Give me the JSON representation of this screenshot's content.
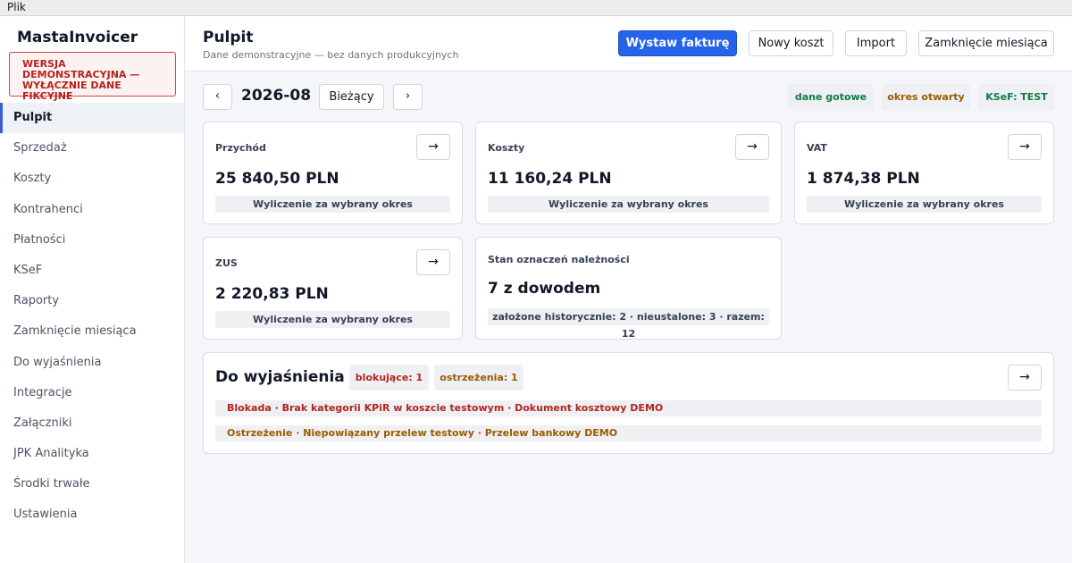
{
  "menubar": {
    "file": "Plik"
  },
  "sidebar": {
    "brand": "MastaInvoicer",
    "demo_banner": "WERSJA DEMONSTRACYJNA — WYŁĄCZNIE DANE FIKCYJNE",
    "items": [
      {
        "label": "Pulpit"
      },
      {
        "label": "Sprzedaż"
      },
      {
        "label": "Koszty"
      },
      {
        "label": "Kontrahenci"
      },
      {
        "label": "Płatności"
      },
      {
        "label": "KSeF"
      },
      {
        "label": "Raporty"
      },
      {
        "label": "Zamknięcie miesiąca"
      },
      {
        "label": "Do wyjaśnienia"
      },
      {
        "label": "Integracje"
      },
      {
        "label": "Załączniki"
      },
      {
        "label": "JPK Analityka"
      },
      {
        "label": "Środki trwałe"
      },
      {
        "label": "Ustawienia"
      }
    ]
  },
  "header": {
    "title": "Pulpit",
    "subtitle": "Dane demonstracyjne — bez danych produkcyjnych",
    "buttons": {
      "issue_invoice": "Wystaw fakturę",
      "new_cost": "Nowy koszt",
      "import": "Import",
      "month_close": "Zamknięcie miesiąca"
    }
  },
  "period": {
    "prev": "‹",
    "label": "2026-08",
    "current": "Bieżący",
    "next": "›"
  },
  "badges": {
    "data_ready": "dane gotowe",
    "period_open": "okres otwarty",
    "ksef": "KSeF: TEST"
  },
  "cards": {
    "revenue": {
      "title": "Przychód",
      "value": "25 840,50 PLN",
      "foot": "Wyliczenie za wybrany okres"
    },
    "costs": {
      "title": "Koszty",
      "value": "11 160,24 PLN",
      "foot": "Wyliczenie za wybrany okres"
    },
    "vat": {
      "title": "VAT",
      "value": "1 874,38 PLN",
      "foot": "Wyliczenie za wybrany okres"
    },
    "zus": {
      "title": "ZUS",
      "value": "2 220,83 PLN",
      "foot": "Wyliczenie za wybrany okres"
    },
    "receivables": {
      "title": "Stan oznaczeń należności",
      "value": "7 z dowodem",
      "foot": "założone historycznie: 2 · nieustalone: 3 · razem: 12"
    }
  },
  "arrow": "→",
  "issues": {
    "title": "Do wyjaśnienia",
    "blocking": "blokujące: 1",
    "warnings": "ostrzeżenia: 1",
    "rows": [
      {
        "text": "Blokada · Brak kategorii KPiR w koszcie testowym · Dokument kosztowy DEMO"
      },
      {
        "text": "Ostrzeżenie · Niepowiązany przelew testowy · Przelew bankowy DEMO"
      }
    ]
  },
  "colors": {
    "primary": "#2563eb",
    "ok": "#0f7a47",
    "warning": "#9a5b00",
    "error": "#b4231c"
  }
}
